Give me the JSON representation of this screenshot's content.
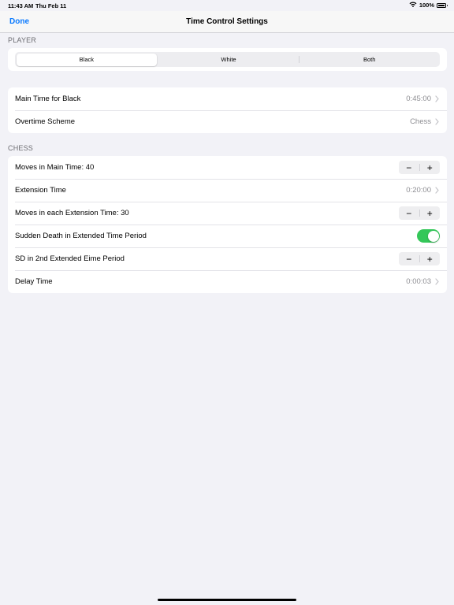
{
  "status_bar": {
    "time": "11:43 AM",
    "date": "Thu Feb 11",
    "battery_percent": "100%",
    "battery_level": 1.0
  },
  "nav": {
    "done_label": "Done",
    "title": "Time Control Settings",
    "accent_color": "#0a7aff"
  },
  "player": {
    "header": "PLAYER",
    "segments": [
      "Black",
      "White",
      "Both"
    ],
    "selected_segment": "Black"
  },
  "main": {
    "rows": [
      {
        "label": "Main Time for Black",
        "value": "0:45:00"
      },
      {
        "label": "Overtime Scheme",
        "value": "Chess"
      }
    ]
  },
  "chess": {
    "header": "CHESS",
    "rows": [
      {
        "label": "Moves in Main Time: 40",
        "control": "stepper"
      },
      {
        "label": "Extension Time",
        "value": "0:20:00",
        "control": "disclosure"
      },
      {
        "label": "Moves in each Extension Time: 30",
        "control": "stepper"
      },
      {
        "label": "Sudden Death in Extended Time Period",
        "control": "toggle",
        "on": true
      },
      {
        "label": "SD in 2nd Extended Eime Period",
        "control": "stepper"
      },
      {
        "label": "Delay Time",
        "value": "0:00:03",
        "control": "disclosure"
      }
    ],
    "toggle_on_color": "#34c759"
  },
  "icons": {
    "minus": "−",
    "plus": "+",
    "chevron": "chevron-right-icon",
    "wifi": "wifi-icon",
    "battery": "battery-icon"
  }
}
